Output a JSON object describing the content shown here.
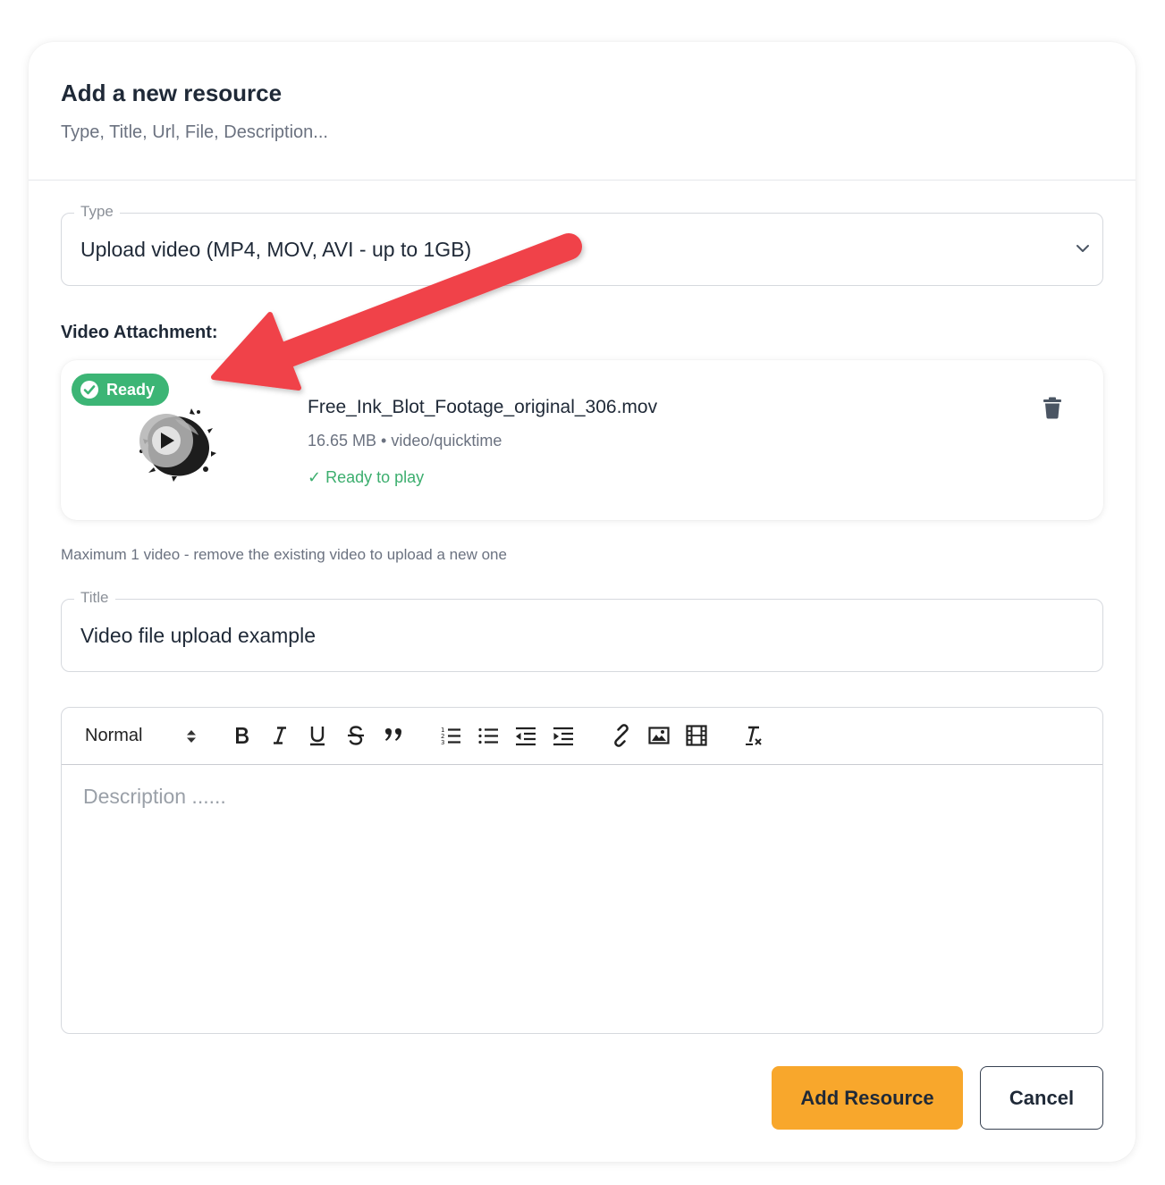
{
  "header": {
    "title": "Add a new resource",
    "subtitle": "Type, Title, Url, File, Description..."
  },
  "type_field": {
    "label": "Type",
    "value": "Upload video (MP4, MOV, AVI - up to 1GB)",
    "icon": "chevron-down-icon"
  },
  "attachment": {
    "section_label": "Video Attachment:",
    "badge": "Ready",
    "file_name": "Free_Ink_Blot_Footage_original_306.mov",
    "file_meta": "16.65 MB • video/quicktime",
    "status": "✓ Ready to play",
    "delete_icon": "trash-icon",
    "hint": "Maximum 1 video - remove the existing video to upload a new one"
  },
  "title_field": {
    "label": "Title",
    "value": "Video file upload example"
  },
  "editor": {
    "format_select": "Normal",
    "toolbar_icons": [
      "bold-icon",
      "italic-icon",
      "underline-icon",
      "strike-icon",
      "quote-icon",
      "ordered-list-icon",
      "bullet-list-icon",
      "outdent-icon",
      "indent-icon",
      "link-icon",
      "image-icon",
      "video-icon",
      "clear-format-icon"
    ],
    "placeholder": "Description ......"
  },
  "actions": {
    "primary": "Add Resource",
    "secondary": "Cancel"
  },
  "colors": {
    "accent": "#f8a72c",
    "success": "#3cb575",
    "annotation_arrow": "#f0434a"
  }
}
